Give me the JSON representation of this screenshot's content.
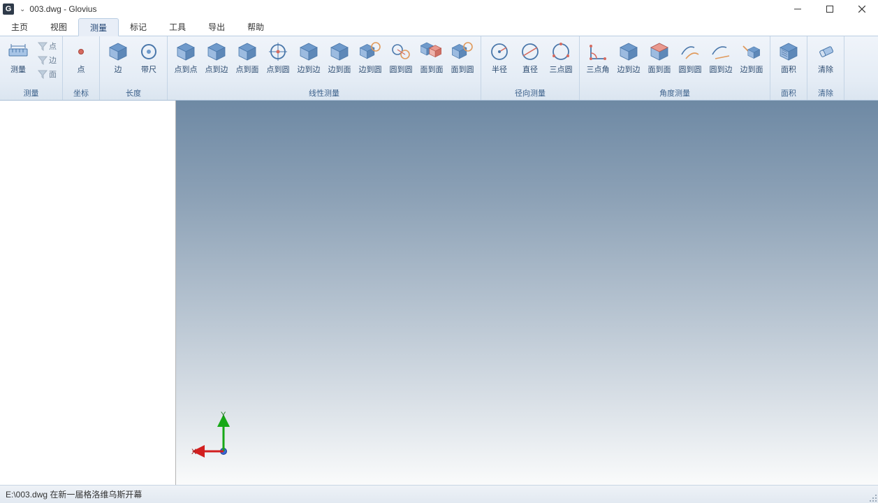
{
  "title": "003.dwg - Glovius",
  "app_badge": "G",
  "menu": {
    "tabs": [
      "主页",
      "视图",
      "测量",
      "标记",
      "工具",
      "导出",
      "帮助"
    ],
    "active_index": 2
  },
  "ribbon": {
    "groups": [
      {
        "title": "测量",
        "big": [
          {
            "label": "测量",
            "icon": "ruler"
          }
        ],
        "side_items": [
          {
            "label": "点",
            "icon": "filter"
          },
          {
            "label": "边",
            "icon": "filter"
          },
          {
            "label": "面",
            "icon": "filter"
          }
        ]
      },
      {
        "title": "坐标",
        "big": [
          {
            "label": "点",
            "icon": "dot"
          }
        ]
      },
      {
        "title": "长度",
        "big": [
          {
            "label": "边",
            "icon": "cube"
          },
          {
            "label": "带尺",
            "icon": "circle-target"
          }
        ]
      },
      {
        "title": "线性测量",
        "big": [
          {
            "label": "点到点",
            "icon": "cube"
          },
          {
            "label": "点到边",
            "icon": "cube"
          },
          {
            "label": "点到面",
            "icon": "cube"
          },
          {
            "label": "点到圆",
            "icon": "circle-cross"
          },
          {
            "label": "边到边",
            "icon": "cube"
          },
          {
            "label": "边到面",
            "icon": "cube"
          },
          {
            "label": "边到圆",
            "icon": "cube-circle"
          },
          {
            "label": "圆到圆",
            "icon": "two-circles"
          },
          {
            "label": "面到面",
            "icon": "cube-pair"
          },
          {
            "label": "面到圆",
            "icon": "cube-circle"
          }
        ]
      },
      {
        "title": "径向测量",
        "big": [
          {
            "label": "半径",
            "icon": "radius"
          },
          {
            "label": "直径",
            "icon": "diameter"
          },
          {
            "label": "三点圆",
            "icon": "three-point"
          }
        ]
      },
      {
        "title": "角度测量",
        "big": [
          {
            "label": "三点角",
            "icon": "angle"
          },
          {
            "label": "边到边",
            "icon": "cube"
          },
          {
            "label": "面到面",
            "icon": "cube-red"
          },
          {
            "label": "圆到圆",
            "icon": "arcs"
          },
          {
            "label": "圆到边",
            "icon": "arc-line"
          },
          {
            "label": "边到面",
            "icon": "line-cube"
          }
        ]
      },
      {
        "title": "面积",
        "big": [
          {
            "label": "面积",
            "icon": "cube-hatch"
          }
        ]
      },
      {
        "title": "清除",
        "big": [
          {
            "label": "清除",
            "icon": "eraser"
          }
        ]
      }
    ]
  },
  "axis": {
    "x": "X",
    "y": "Y"
  },
  "status": "E:\\003.dwg 在新一届格洛维乌斯开幕"
}
